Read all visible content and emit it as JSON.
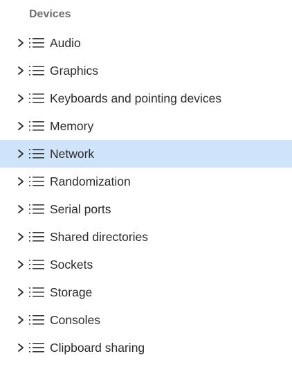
{
  "section": {
    "title": "Devices"
  },
  "items": [
    {
      "label": "Audio",
      "selected": false
    },
    {
      "label": "Graphics",
      "selected": false
    },
    {
      "label": "Keyboards and pointing devices",
      "selected": false
    },
    {
      "label": "Memory",
      "selected": false
    },
    {
      "label": "Network",
      "selected": true
    },
    {
      "label": "Randomization",
      "selected": false
    },
    {
      "label": "Serial ports",
      "selected": false
    },
    {
      "label": "Shared directories",
      "selected": false
    },
    {
      "label": "Sockets",
      "selected": false
    },
    {
      "label": "Storage",
      "selected": false
    },
    {
      "label": "Consoles",
      "selected": false
    },
    {
      "label": "Clipboard sharing",
      "selected": false
    }
  ],
  "colors": {
    "selected_background": "#cfe3f9",
    "header_text": "#6f6f6f",
    "item_text": "#2b2b2b",
    "icon": "#3a3a3a"
  },
  "icons": {
    "expander": "chevron-right-icon",
    "item": "list-icon"
  }
}
